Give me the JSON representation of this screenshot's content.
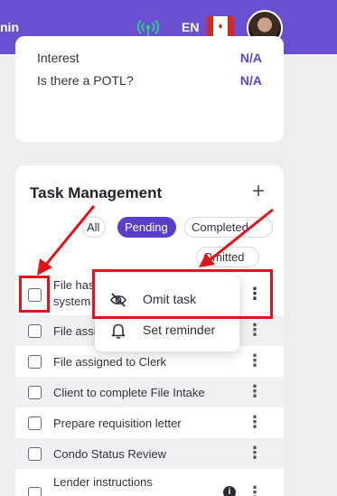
{
  "topbar": {
    "cut_text": "nin",
    "language": "EN",
    "flag_icon": "canada-flag-icon",
    "signal_icon": "wifi-signal-icon"
  },
  "info_card": {
    "rows": [
      {
        "label": "Interest",
        "value": "N/A"
      },
      {
        "label": "Is there a POTL?",
        "value": "N/A"
      }
    ]
  },
  "task_management": {
    "title": "Task Management",
    "add_icon": "plus-icon",
    "filters": [
      "All",
      "Pending",
      "Completed",
      "Omitted"
    ],
    "active_filter": "Pending",
    "tasks": [
      {
        "label": "File has been system",
        "line1": "File has",
        "line2": "system"
      },
      {
        "label": "File assigned to Lawyer",
        "short": "File assi"
      },
      {
        "label": "File assigned to Clerk"
      },
      {
        "label": "Client to complete File Intake"
      },
      {
        "label": "Prepare requisition letter"
      },
      {
        "label": "Condo Status Review"
      },
      {
        "label": "Lender instructions"
      }
    ]
  },
  "context_menu": {
    "items": [
      {
        "label": "Omit task",
        "icon": "eye-off-icon"
      },
      {
        "label": "Set reminder",
        "icon": "bell-icon"
      }
    ]
  },
  "colors": {
    "brand": "#6a4fd0",
    "accent": "#5b3ec8",
    "annotation": "#e3131b"
  }
}
